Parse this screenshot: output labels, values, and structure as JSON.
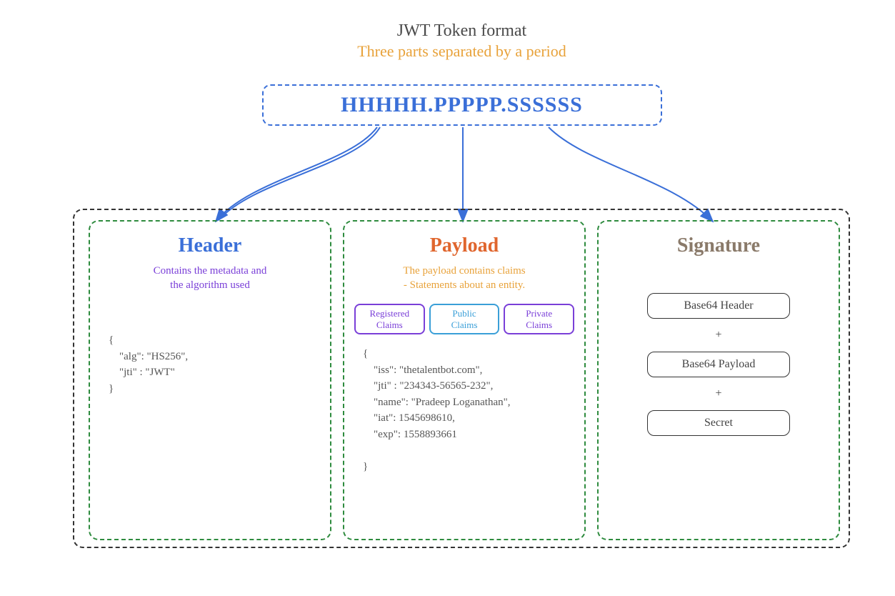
{
  "title": {
    "line1": "JWT Token format",
    "line2": "Three parts separated by a period"
  },
  "token_format": "HHHHH.PPPPP.SSSSSS",
  "columns": {
    "header": {
      "title": "Header",
      "subtitle": "Contains the metadata and\nthe algorithm used",
      "code": "{\n    \"alg\": \"HS256\",\n    \"jti\" : \"JWT\"\n}"
    },
    "payload": {
      "title": "Payload",
      "subtitle": "The payload contains claims\n- Statements about an entity.",
      "claims": {
        "registered": "Registered\nClaims",
        "public": "Public\nClaims",
        "private": "Private\nClaims"
      },
      "code": "{\n    \"iss\": \"thetalentbot.com\",\n    \"jti\" : \"234343-56565-232\",\n    \"name\": \"Pradeep Loganathan\",\n    \"iat\": 1545698610,\n    \"exp\": 1558893661\n\n}"
    },
    "signature": {
      "title": "Signature",
      "items": [
        "Base64 Header",
        "Base64 Payload",
        "Secret"
      ],
      "plus": "+"
    }
  }
}
